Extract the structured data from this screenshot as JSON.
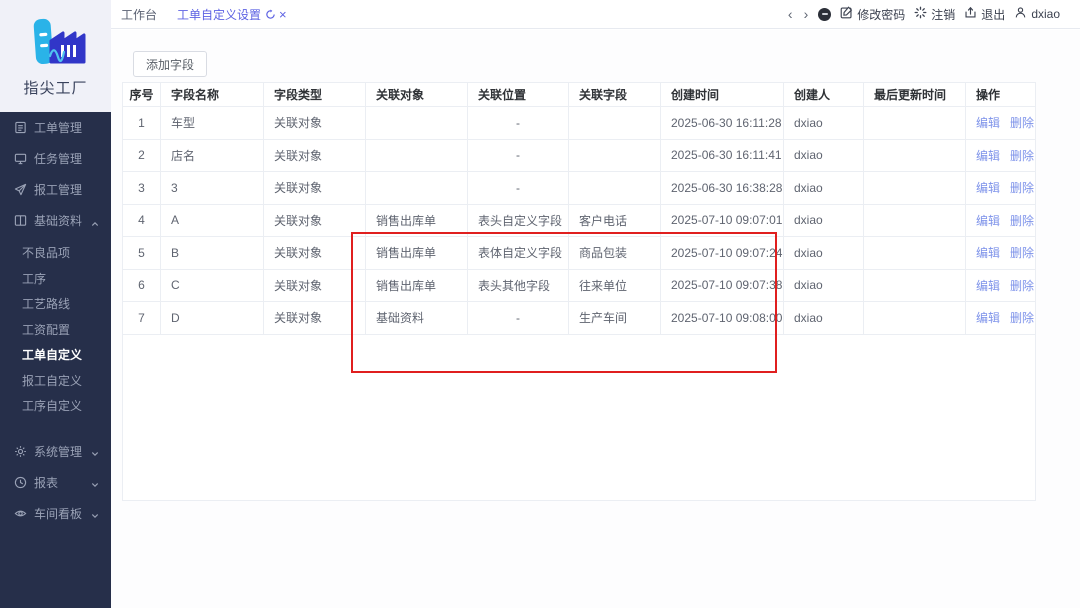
{
  "app": {
    "name": "指尖工厂"
  },
  "sidebar": {
    "items": [
      {
        "id": "work-orders",
        "label": "工单管理",
        "icon": "document-icon"
      },
      {
        "id": "tasks",
        "label": "任务管理",
        "icon": "monitor-icon"
      },
      {
        "id": "work-reporting",
        "label": "报工管理",
        "icon": "send-icon"
      },
      {
        "id": "base-data",
        "label": "基础资料",
        "icon": "book-icon",
        "expanded": true,
        "children": [
          {
            "id": "defect-items",
            "label": "不良品项"
          },
          {
            "id": "process",
            "label": "工序"
          },
          {
            "id": "process-route",
            "label": "工艺路线"
          },
          {
            "id": "wage-config",
            "label": "工资配置"
          },
          {
            "id": "work-order-custom",
            "label": "工单自定义",
            "active": true
          },
          {
            "id": "report-custom",
            "label": "报工自定义"
          },
          {
            "id": "process-custom",
            "label": "工序自定义"
          }
        ]
      },
      {
        "id": "system-mgmt",
        "label": "系统管理",
        "icon": "gear-icon",
        "collapsed": true
      },
      {
        "id": "reports",
        "label": "报表",
        "icon": "clock-icon",
        "collapsed": true
      },
      {
        "id": "workshop-board",
        "label": "车间看板",
        "icon": "eye-icon",
        "collapsed": true
      }
    ]
  },
  "topbar": {
    "tabs": [
      {
        "label": "工作台",
        "active": false
      },
      {
        "label": "工单自定义设置",
        "active": true,
        "icons": [
          "refresh-icon",
          "close-icon"
        ]
      }
    ],
    "right": {
      "change_password": "修改密码",
      "logout": "注销",
      "exit": "退出",
      "username": "dxiao"
    }
  },
  "toolbar": {
    "add_field_label": "添加字段"
  },
  "table": {
    "headers": [
      "序号",
      "字段名称",
      "字段类型",
      "关联对象",
      "关联位置",
      "关联字段",
      "创建时间",
      "创建人",
      "最后更新时间",
      "操作"
    ],
    "action_labels": {
      "edit": "编辑",
      "delete": "删除"
    },
    "rows": [
      {
        "no": "1",
        "name": "车型",
        "type": "关联对象",
        "object": "",
        "position": "-",
        "field": "",
        "created": "2025-06-30 16:11:28",
        "creator": "dxiao",
        "updated": ""
      },
      {
        "no": "2",
        "name": "店名",
        "type": "关联对象",
        "object": "",
        "position": "-",
        "field": "",
        "created": "2025-06-30 16:11:41",
        "creator": "dxiao",
        "updated": ""
      },
      {
        "no": "3",
        "name": "3",
        "type": "关联对象",
        "object": "",
        "position": "-",
        "field": "",
        "created": "2025-06-30 16:38:28",
        "creator": "dxiao",
        "updated": ""
      },
      {
        "no": "4",
        "name": "A",
        "type": "关联对象",
        "object": "销售出库单",
        "position": "表头自定义字段",
        "field": "客户电话",
        "created": "2025-07-10 09:07:01",
        "creator": "dxiao",
        "updated": ""
      },
      {
        "no": "5",
        "name": "B",
        "type": "关联对象",
        "object": "销售出库单",
        "position": "表体自定义字段",
        "field": "商品包装",
        "created": "2025-07-10 09:07:24",
        "creator": "dxiao",
        "updated": ""
      },
      {
        "no": "6",
        "name": "C",
        "type": "关联对象",
        "object": "销售出库单",
        "position": "表头其他字段",
        "field": "往来单位",
        "created": "2025-07-10 09:07:38",
        "creator": "dxiao",
        "updated": ""
      },
      {
        "no": "7",
        "name": "D",
        "type": "关联对象",
        "object": "基础资料",
        "position": "-",
        "field": "生产车间",
        "created": "2025-07-10 09:08:00",
        "creator": "dxiao",
        "updated": ""
      }
    ]
  },
  "annotation": {
    "type": "highlight-rectangle",
    "color": "#e01f1f"
  },
  "colors": {
    "sidebar_bg": "#262f4a",
    "logo_cyan": "#2ab3e8",
    "logo_indigo": "#3136c8",
    "active_tab": "#5d62e3",
    "link": "#7e93ea",
    "table_border": "#ebeef3"
  }
}
